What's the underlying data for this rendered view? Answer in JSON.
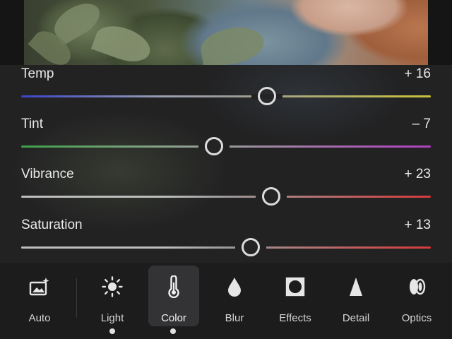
{
  "sliders": [
    {
      "label": "Temp",
      "value": "+ 16",
      "level": 0.6,
      "left_color": "#3a44c8",
      "right_color": "#c9c23a",
      "left_mid": "#9aa0b0"
    },
    {
      "label": "Tint",
      "value": "– 7",
      "level": 0.47,
      "left_color": "#3ea04a",
      "right_color": "#b03ec0",
      "left_mid": "#8aa28a"
    },
    {
      "label": "Vibrance",
      "value": "+ 23",
      "level": 0.61,
      "left_color": "#bdbdbd",
      "right_color": "#d63a3a",
      "left_mid": "#bdbdbd"
    },
    {
      "label": "Saturation",
      "value": "+ 13",
      "level": 0.56,
      "left_color": "#bdbdbd",
      "right_color": "#d63a3a",
      "left_mid": "#bdbdbd"
    }
  ],
  "toolbar": {
    "auto": "Auto",
    "light": "Light",
    "color": "Color",
    "blur": "Blur",
    "effects": "Effects",
    "detail": "Detail",
    "optics": "Optics",
    "active": "color"
  }
}
